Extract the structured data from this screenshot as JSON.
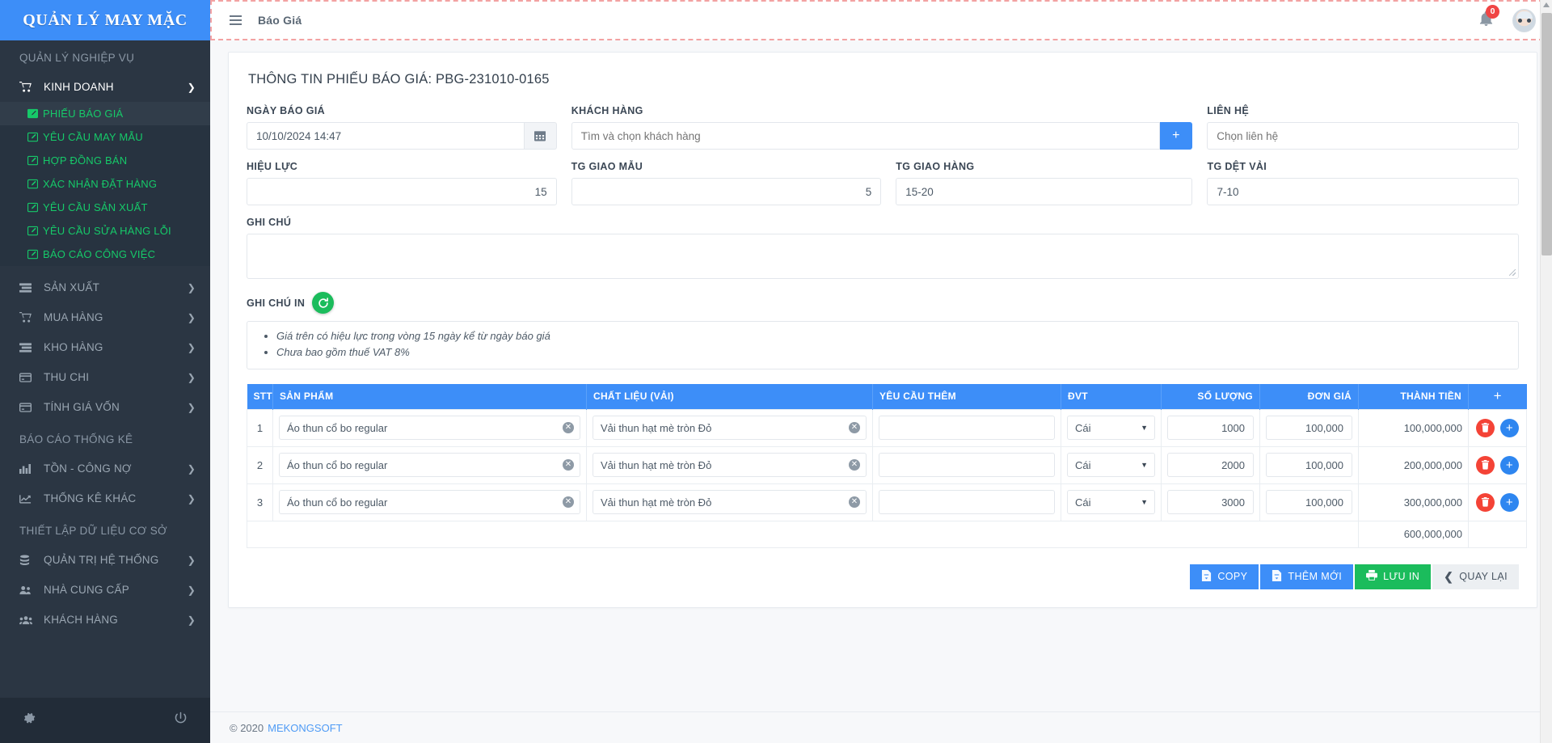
{
  "brand": {
    "title": "QUẢN LÝ MAY MẶC"
  },
  "sidebar": {
    "heading_1": "QUẢN LÝ NGHIỆP VỤ",
    "heading_2": "BÁO CÁO THỐNG KÊ",
    "heading_3": "THIẾT LẬP DỮ LIỆU CƠ SỞ",
    "group_kinh_doanh": {
      "label": "KINH DOANH",
      "icon": "cart-icon",
      "caret": "chevron-down-icon"
    },
    "sub_items": [
      {
        "label": "PHIẾU BÁO GIÁ",
        "icon": "edit-icon"
      },
      {
        "label": "YÊU CẦU MAY MẪU",
        "icon": "edit-icon"
      },
      {
        "label": "HỢP ĐỒNG BÁN",
        "icon": "edit-icon"
      },
      {
        "label": "XÁC NHẬN ĐẶT HÀNG",
        "icon": "edit-icon"
      },
      {
        "label": "YÊU CẦU SẢN XUẤT",
        "icon": "edit-icon"
      },
      {
        "label": "YÊU CẦU SỬA HÀNG LỖI",
        "icon": "edit-icon"
      },
      {
        "label": "BÁO CÁO CÔNG VIỆC",
        "icon": "edit-icon"
      }
    ],
    "group_items_1": [
      {
        "label": "SẢN XUẤT",
        "icon": "list-icon"
      },
      {
        "label": "MUA HÀNG",
        "icon": "cart-icon"
      },
      {
        "label": "KHO HÀNG",
        "icon": "list-icon"
      },
      {
        "label": "THU CHI",
        "icon": "card-icon"
      },
      {
        "label": "TÍNH GIÁ VỐN",
        "icon": "card-icon"
      }
    ],
    "group_items_2": [
      {
        "label": "TỒN - CÔNG NỢ",
        "icon": "bar-chart-icon"
      },
      {
        "label": "THỐNG KÊ KHÁC",
        "icon": "line-chart-icon"
      }
    ],
    "group_items_3": [
      {
        "label": "QUẢN TRỊ HỆ THỐNG",
        "icon": "database-icon"
      },
      {
        "label": "NHÀ CUNG CẤP",
        "icon": "users-icon"
      },
      {
        "label": "KHÁCH HÀNG",
        "icon": "group-icon"
      }
    ],
    "footer": {
      "settings_icon": "gear-icon",
      "power_icon": "power-icon"
    }
  },
  "topbar": {
    "menu_icon": "hamburger-icon",
    "title": "Báo Giá",
    "bell_icon": "bell-icon",
    "bell_count": "0",
    "avatar": "user-avatar"
  },
  "page": {
    "title": "THÔNG TIN PHIẾU BÁO GIÁ: PBG-231010-0165"
  },
  "form": {
    "ngay_bao_gia": {
      "label": "NGÀY BÁO GIÁ",
      "value": "10/10/2024 14:47",
      "icon": "calendar-icon"
    },
    "khach_hang": {
      "label": "KHÁCH HÀNG",
      "placeholder": "Tìm và chọn khách hàng",
      "value": "",
      "add_icon": "plus-icon"
    },
    "lien_he": {
      "label": "LIÊN HỆ",
      "placeholder": "Chọn liên hệ",
      "value": ""
    },
    "hieu_luc": {
      "label": "HIỆU LỰC",
      "value": "15"
    },
    "tg_giao_mau": {
      "label": "TG GIAO MẪU",
      "value": "5"
    },
    "tg_giao_hang": {
      "label": "TG GIAO HÀNG",
      "value": "15-20"
    },
    "tg_det_vai": {
      "label": "TG DỆT VẢI",
      "value": "7-10"
    },
    "ghi_chu": {
      "label": "GHI CHÚ",
      "value": ""
    },
    "ghi_chu_in": {
      "label": "GHI CHÚ IN",
      "refresh_icon": "refresh-icon",
      "notes": [
        "Giá trên có hiệu lực trong vòng 15 ngày kể từ ngày báo giá",
        "Chưa bao gồm thuế VAT 8%"
      ]
    }
  },
  "table": {
    "columns": [
      "STT",
      "SẢN PHẨM",
      "CHẤT LIỆU (VẢI)",
      "YÊU CẦU THÊM",
      "ĐVT",
      "SỐ LƯỢNG",
      "ĐƠN GIÁ",
      "THÀNH TIỀN"
    ],
    "add_column_icon": "plus-icon",
    "rows": [
      {
        "stt": "1",
        "san_pham": "Áo thun cổ bo regular",
        "chat_lieu": "Vải thun hạt mè tròn Đỏ",
        "yeu_cau_them": "",
        "dvt": "Cái",
        "so_luong": "1000",
        "don_gia": "100,000",
        "thanh_tien": "100,000,000",
        "delete_icon": "trash-icon",
        "add_icon": "plus-icon"
      },
      {
        "stt": "2",
        "san_pham": "Áo thun cổ bo regular",
        "chat_lieu": "Vải thun hạt mè tròn Đỏ",
        "yeu_cau_them": "",
        "dvt": "Cái",
        "so_luong": "2000",
        "don_gia": "100,000",
        "thanh_tien": "200,000,000",
        "delete_icon": "trash-icon",
        "add_icon": "plus-icon"
      },
      {
        "stt": "3",
        "san_pham": "Áo thun cổ bo regular",
        "chat_lieu": "Vải thun hạt mè tròn Đỏ",
        "yeu_cau_them": "",
        "dvt": "Cái",
        "so_luong": "3000",
        "don_gia": "100,000",
        "thanh_tien": "300,000,000",
        "delete_icon": "trash-icon",
        "add_icon": "plus-icon"
      }
    ],
    "total": "600,000,000",
    "clear_icon": "clear-circle-icon"
  },
  "buttons": {
    "copy": {
      "label": "COPY",
      "icon": "file-copy-icon"
    },
    "them_moi": {
      "label": "THÊM MỚI",
      "icon": "file-add-icon"
    },
    "luu_in": {
      "label": "LƯU IN",
      "icon": "printer-icon"
    },
    "quay_lai": {
      "label": "QUAY LẠI",
      "icon": "chevron-left-icon"
    }
  },
  "footer": {
    "copyright": "© 2020",
    "company": "MEKONGSOFT"
  },
  "colors": {
    "brand_blue": "#3d8ef8",
    "sidebar_dark": "#2b3643",
    "sidebar_sub": "#273340",
    "green": "#1bbc5c",
    "sub_link_green": "#16c969",
    "red": "#f44336",
    "badge_red": "#f04545"
  }
}
